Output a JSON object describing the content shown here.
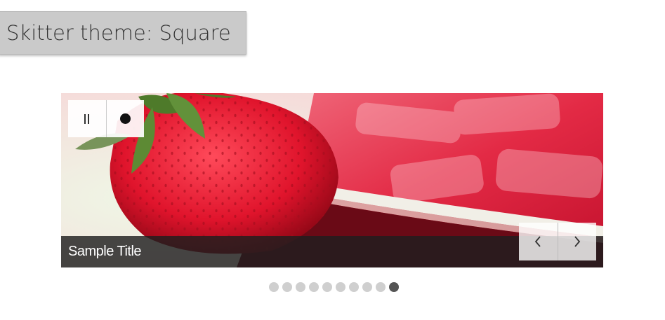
{
  "header": {
    "title": "Skitter theme: Square"
  },
  "slider": {
    "caption": "Sample Title",
    "controls": {
      "pause_icon": "pause-icon",
      "play_icon": "dot-icon"
    },
    "navigation": {
      "prev_icon": "chevron-left-icon",
      "next_icon": "chevron-right-icon"
    },
    "pagination": {
      "total": 10,
      "active_index": 9
    }
  },
  "colors": {
    "title_bg": "#cacaca",
    "caption_bg": "#1e1e1e",
    "dot_inactive": "#cfcfcf",
    "dot_active": "#555555"
  }
}
